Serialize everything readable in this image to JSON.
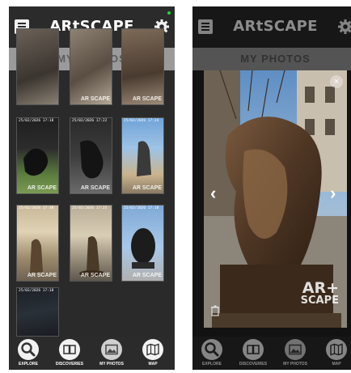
{
  "app": {
    "brand": "ARtSCAPE",
    "section_title": "MY PHOTOS"
  },
  "gallery": {
    "photos": [
      {
        "timestamp": "",
        "watermark": ""
      },
      {
        "timestamp": "",
        "watermark": "AR SCAPE"
      },
      {
        "timestamp": "",
        "watermark": "AR SCAPE"
      },
      {
        "timestamp": "25/02/2026 17:18",
        "watermark": "AR SCAPE"
      },
      {
        "timestamp": "25/02/2026 17:22",
        "watermark": "AR SCAPE"
      },
      {
        "timestamp": "25/02/2026 17:24",
        "watermark": "AR SCAPE"
      },
      {
        "timestamp": "25/02/2026 17:30",
        "watermark": "AR SCAPE"
      },
      {
        "timestamp": "25/02/2026 17:25",
        "watermark": "AR SCAPE"
      },
      {
        "timestamp": "25/02/2026 17:18",
        "watermark": "AR SCAPE"
      },
      {
        "timestamp": "25/02/2026 17:18",
        "watermark": ""
      }
    ]
  },
  "viewer": {
    "watermark_top": "AR+",
    "watermark_bottom": "SCAPE",
    "prev_arrow": "‹",
    "next_arrow": "›",
    "close_symbol": "×"
  },
  "nav": {
    "explore": "EXPLORE",
    "discoveries": "DISCOVERIES",
    "my_photos": "MY PHOTOS",
    "map": "MAP"
  },
  "icons": {
    "menu": "menu-icon",
    "settings": "gear-icon",
    "explore": "magnifier-icon",
    "discoveries": "book-icon",
    "my_photos": "picture-icon",
    "map": "folded-map-icon",
    "close": "close-icon",
    "delete": "trash-icon"
  },
  "colors": {
    "bar": "#2b2b2b",
    "section": "#9a9a9a",
    "section_text": "#5c5c5c",
    "nav_circle": "#f2f2f2",
    "status": "#2ecc40"
  }
}
